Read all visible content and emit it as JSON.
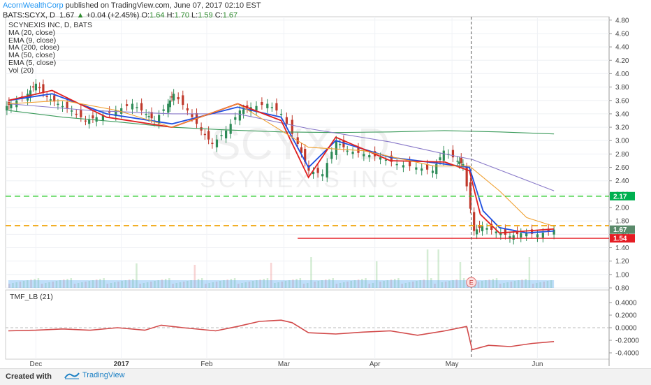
{
  "header": {
    "author": "AcornWealthCorp",
    "published": "published on TradingView.com, June 07, 2017 02:10 EST",
    "symbol": "BATS:SCYX, D",
    "price": "1.67",
    "change": "+0.04 (+2.45%)",
    "ohlc": [
      {
        "label": "O:",
        "value": "1.64"
      },
      {
        "label": "H:",
        "value": "1.70"
      },
      {
        "label": "L:",
        "value": "1.59"
      },
      {
        "label": "C:",
        "value": "1.67"
      }
    ]
  },
  "legend": {
    "items": [
      "SCYNEXIS INC, D, BATS",
      "MA (20, close)",
      "EMA (9, close)",
      "MA (200, close)",
      "MA (50, close)",
      "EMA (5, close)",
      "Vol (20)"
    ]
  },
  "watermark": {
    "ticker": "SCYX, D",
    "company": "SCYNEXIS INC"
  },
  "footer": {
    "created_with": "Created with",
    "brand": "TradingView"
  },
  "chart_data": [
    {
      "type": "candlestick",
      "title": "SCYNEXIS INC, D, BATS",
      "ylim": [
        0.8,
        4.85
      ],
      "y_ticks": [
        "4.80",
        "4.60",
        "4.40",
        "4.20",
        "4.00",
        "3.80",
        "3.60",
        "3.40",
        "3.20",
        "3.00",
        "2.80",
        "2.60",
        "2.40",
        "2.20",
        "2.00",
        "1.80",
        "1.60",
        "1.40",
        "1.20",
        "1.00",
        "0.80"
      ],
      "x_ticks": [
        "Dec",
        "2017",
        "Feb",
        "Mar",
        "Apr",
        "May",
        "Jun"
      ],
      "price_labels": [
        {
          "value": 2.17,
          "text": "2.17",
          "color": "#00b050"
        },
        {
          "value": 1.67,
          "text": "1.67",
          "color": "#5a8a6a"
        },
        {
          "value": 1.54,
          "text": "1.54",
          "color": "#e51c23"
        }
      ],
      "hlines": [
        {
          "value": 2.17,
          "color": "#33cc33",
          "style": "dashed"
        },
        {
          "value": 1.73,
          "color": "#f0a000",
          "style": "dashed"
        },
        {
          "value": 1.54,
          "color": "#e51c23",
          "style": "solid",
          "from_date": "Mar 6"
        }
      ],
      "vline": {
        "date": "May 8",
        "style": "dashed"
      },
      "earnings_marker": {
        "date": "May 8",
        "text": "E"
      },
      "close_approx": [
        [
          "Nov 22",
          3.55
        ],
        [
          "Nov 28",
          3.7
        ],
        [
          "Dec 1",
          3.85
        ],
        [
          "Dec 5",
          3.65
        ],
        [
          "Dec 9",
          3.55
        ],
        [
          "Dec 14",
          3.45
        ],
        [
          "Dec 19",
          3.3
        ],
        [
          "Dec 23",
          3.35
        ],
        [
          "Dec 30",
          3.45
        ],
        [
          "Jan 5",
          3.55
        ],
        [
          "Jan 10",
          3.4
        ],
        [
          "Jan 13",
          3.3
        ],
        [
          "Jan 18",
          3.55
        ],
        [
          "Jan 20",
          3.7
        ],
        [
          "Jan 25",
          3.45
        ],
        [
          "Jan 30",
          3.15
        ],
        [
          "Feb 3",
          2.95
        ],
        [
          "Feb 8",
          3.15
        ],
        [
          "Feb 13",
          3.45
        ],
        [
          "Feb 17",
          3.5
        ],
        [
          "Feb 23",
          3.55
        ],
        [
          "Feb 28",
          3.4
        ],
        [
          "Mar 6",
          2.95
        ],
        [
          "Mar 10",
          2.55
        ],
        [
          "Mar 15",
          2.5
        ],
        [
          "Mar 20",
          3.0
        ],
        [
          "Mar 24",
          2.85
        ],
        [
          "Mar 30",
          2.8
        ],
        [
          "Apr 5",
          2.75
        ],
        [
          "Apr 11",
          2.65
        ],
        [
          "Apr 18",
          2.6
        ],
        [
          "Apr 24",
          2.55
        ],
        [
          "Apr 28",
          2.85
        ],
        [
          "May 3",
          2.7
        ],
        [
          "May 5",
          2.65
        ],
        [
          "May 9",
          1.65
        ],
        [
          "May 12",
          1.72
        ],
        [
          "May 17",
          1.64
        ],
        [
          "May 22",
          1.57
        ],
        [
          "May 26",
          1.62
        ],
        [
          "Jun 1",
          1.6
        ],
        [
          "Jun 7",
          1.67
        ]
      ],
      "series": [
        {
          "name": "MA (200, close)",
          "color": "#3a9a5a",
          "values": [
            [
              0.0,
              3.45
            ],
            [
              0.1,
              3.35
            ],
            [
              0.2,
              3.28
            ],
            [
              0.3,
              3.2
            ],
            [
              0.4,
              3.16
            ],
            [
              0.5,
              3.13
            ],
            [
              0.6,
              3.12
            ],
            [
              0.7,
              3.13
            ],
            [
              0.8,
              3.15
            ],
            [
              0.9,
              3.13
            ],
            [
              1.0,
              3.1
            ]
          ]
        },
        {
          "name": "MA (50, close)",
          "color": "#8878c8",
          "values": [
            [
              0.0,
              3.55
            ],
            [
              0.15,
              3.45
            ],
            [
              0.3,
              3.4
            ],
            [
              0.42,
              3.4
            ],
            [
              0.55,
              3.18
            ],
            [
              0.7,
              2.98
            ],
            [
              0.8,
              2.8
            ],
            [
              0.85,
              2.72
            ],
            [
              0.92,
              2.5
            ],
            [
              1.0,
              2.25
            ]
          ]
        },
        {
          "name": "EMA (9, close)",
          "color": "#1f4fe0",
          "values": [
            [
              0.0,
              3.6
            ],
            [
              0.08,
              3.7
            ],
            [
              0.18,
              3.4
            ],
            [
              0.3,
              3.25
            ],
            [
              0.42,
              3.5
            ],
            [
              0.5,
              3.35
            ],
            [
              0.55,
              2.6
            ],
            [
              0.6,
              3.0
            ],
            [
              0.7,
              2.75
            ],
            [
              0.8,
              2.65
            ],
            [
              0.845,
              2.6
            ],
            [
              0.87,
              1.95
            ],
            [
              0.9,
              1.7
            ],
            [
              0.95,
              1.62
            ],
            [
              1.0,
              1.65
            ]
          ]
        },
        {
          "name": "EMA (5, close)",
          "color": "#e02020",
          "values": [
            [
              0.0,
              3.6
            ],
            [
              0.08,
              3.75
            ],
            [
              0.18,
              3.35
            ],
            [
              0.3,
              3.2
            ],
            [
              0.42,
              3.55
            ],
            [
              0.5,
              3.3
            ],
            [
              0.55,
              2.45
            ],
            [
              0.6,
              3.05
            ],
            [
              0.7,
              2.7
            ],
            [
              0.8,
              2.68
            ],
            [
              0.845,
              2.55
            ],
            [
              0.865,
              1.9
            ],
            [
              0.9,
              1.62
            ],
            [
              1.0,
              1.68
            ]
          ]
        },
        {
          "name": "MA (20, close)",
          "color": "#f0a030",
          "values": [
            [
              0.0,
              3.55
            ],
            [
              0.1,
              3.6
            ],
            [
              0.2,
              3.45
            ],
            [
              0.3,
              3.2
            ],
            [
              0.42,
              3.55
            ],
            [
              0.55,
              2.9
            ],
            [
              0.65,
              2.85
            ],
            [
              0.78,
              2.62
            ],
            [
              0.845,
              2.62
            ],
            [
              0.9,
              2.25
            ],
            [
              0.95,
              1.85
            ],
            [
              1.0,
              1.72
            ]
          ]
        }
      ]
    },
    {
      "type": "line",
      "title": "TMF_LB (21)",
      "ylim": [
        -0.5,
        0.6
      ],
      "y_ticks": [
        "0.4000",
        "0.2000",
        "0.0000",
        "-0.2000",
        "-0.4000"
      ],
      "series": [
        {
          "name": "TMF_LB (21)",
          "color": "#d24a4a",
          "values": [
            [
              0.0,
              -0.05
            ],
            [
              0.05,
              -0.04
            ],
            [
              0.1,
              -0.02
            ],
            [
              0.15,
              -0.04
            ],
            [
              0.2,
              0.0
            ],
            [
              0.25,
              -0.04
            ],
            [
              0.28,
              0.04
            ],
            [
              0.32,
              0.0
            ],
            [
              0.38,
              -0.05
            ],
            [
              0.42,
              0.02
            ],
            [
              0.46,
              0.1
            ],
            [
              0.5,
              0.12
            ],
            [
              0.52,
              0.08
            ],
            [
              0.55,
              -0.08
            ],
            [
              0.6,
              -0.1
            ],
            [
              0.65,
              -0.07
            ],
            [
              0.7,
              -0.05
            ],
            [
              0.75,
              -0.12
            ],
            [
              0.8,
              -0.05
            ],
            [
              0.84,
              0.02
            ],
            [
              0.85,
              -0.35
            ],
            [
              0.88,
              -0.28
            ],
            [
              0.92,
              -0.3
            ],
            [
              0.96,
              -0.25
            ],
            [
              1.0,
              -0.22
            ]
          ]
        }
      ]
    }
  ]
}
